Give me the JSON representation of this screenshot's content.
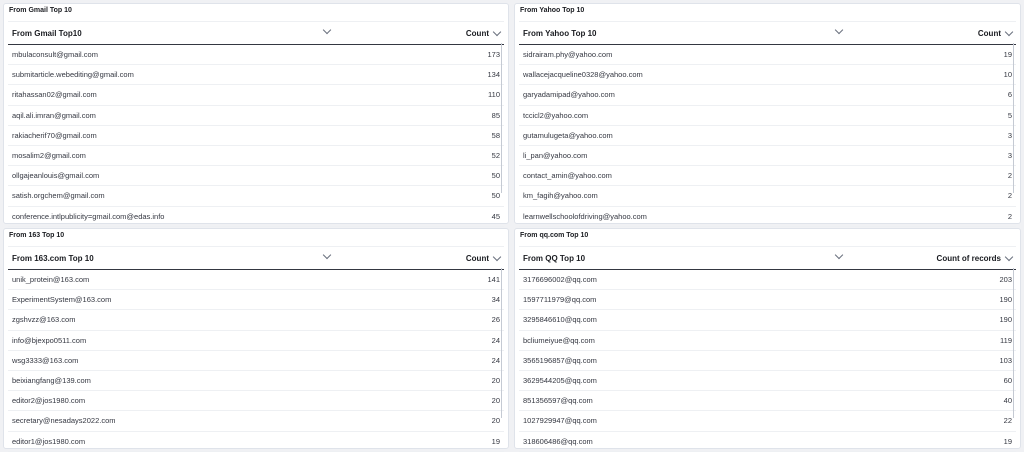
{
  "panels": [
    {
      "title": "From Gmail Top 10",
      "col_name": "From Gmail Top10",
      "col_count": "Count",
      "rows": [
        {
          "name": "mbulaconsult@gmail.com",
          "count": "173"
        },
        {
          "name": "submitarticle.webediting@gmail.com",
          "count": "134"
        },
        {
          "name": "ritahassan02@gmail.com",
          "count": "110"
        },
        {
          "name": "aqil.ali.imran@gmail.com",
          "count": "85"
        },
        {
          "name": "rakiacherif70@gmail.com",
          "count": "58"
        },
        {
          "name": "mosalim2@gmail.com",
          "count": "52"
        },
        {
          "name": "ollgajeanlouis@gmail.com",
          "count": "50"
        },
        {
          "name": "satish.orgchem@gmail.com",
          "count": "50"
        },
        {
          "name": "conference.intlpublicity=gmail.com@edas.info",
          "count": "45"
        }
      ]
    },
    {
      "title": "From Yahoo Top 10",
      "col_name": "From Yahoo Top 10",
      "col_count": "Count",
      "rows": [
        {
          "name": "sidrairam.phy@yahoo.com",
          "count": "19"
        },
        {
          "name": "wallacejacqueline0328@yahoo.com",
          "count": "10"
        },
        {
          "name": "garyadamipad@yahoo.com",
          "count": "6"
        },
        {
          "name": "tccicl2@yahoo.com",
          "count": "5"
        },
        {
          "name": "gutamulugeta@yahoo.com",
          "count": "3"
        },
        {
          "name": "li_pan@yahoo.com",
          "count": "3"
        },
        {
          "name": "contact_amin@yahoo.com",
          "count": "2"
        },
        {
          "name": "km_fagih@yahoo.com",
          "count": "2"
        },
        {
          "name": "learnwellschoolofdriving@yahoo.com",
          "count": "2"
        }
      ]
    },
    {
      "title": "From 163 Top 10",
      "col_name": "From 163.com Top 10",
      "col_count": "Count",
      "rows": [
        {
          "name": "unik_protein@163.com",
          "count": "141"
        },
        {
          "name": "ExperimentSystem@163.com",
          "count": "34"
        },
        {
          "name": "zgshvzz@163.com",
          "count": "26"
        },
        {
          "name": "info@bjexpo0511.com",
          "count": "24"
        },
        {
          "name": "wsg3333@163.com",
          "count": "24"
        },
        {
          "name": "beixiangfang@139.com",
          "count": "20"
        },
        {
          "name": "editor2@jos1980.com",
          "count": "20"
        },
        {
          "name": "secretary@nesadays2022.com",
          "count": "20"
        },
        {
          "name": "editor1@jos1980.com",
          "count": "19"
        }
      ]
    },
    {
      "title": "From qq.com Top 10",
      "col_name": "From QQ Top 10",
      "col_count": "Count of records",
      "rows": [
        {
          "name": "3176696002@qq.com",
          "count": "203"
        },
        {
          "name": "1597711979@qq.com",
          "count": "190"
        },
        {
          "name": "3295846610@qq.com",
          "count": "190"
        },
        {
          "name": "bcliumeiyue@qq.com",
          "count": "119"
        },
        {
          "name": "3565196857@qq.com",
          "count": "103"
        },
        {
          "name": "3629544205@qq.com",
          "count": "60"
        },
        {
          "name": "851356597@qq.com",
          "count": "40"
        },
        {
          "name": "1027929947@qq.com",
          "count": "22"
        },
        {
          "name": "318606486@qq.com",
          "count": "19"
        }
      ]
    }
  ]
}
